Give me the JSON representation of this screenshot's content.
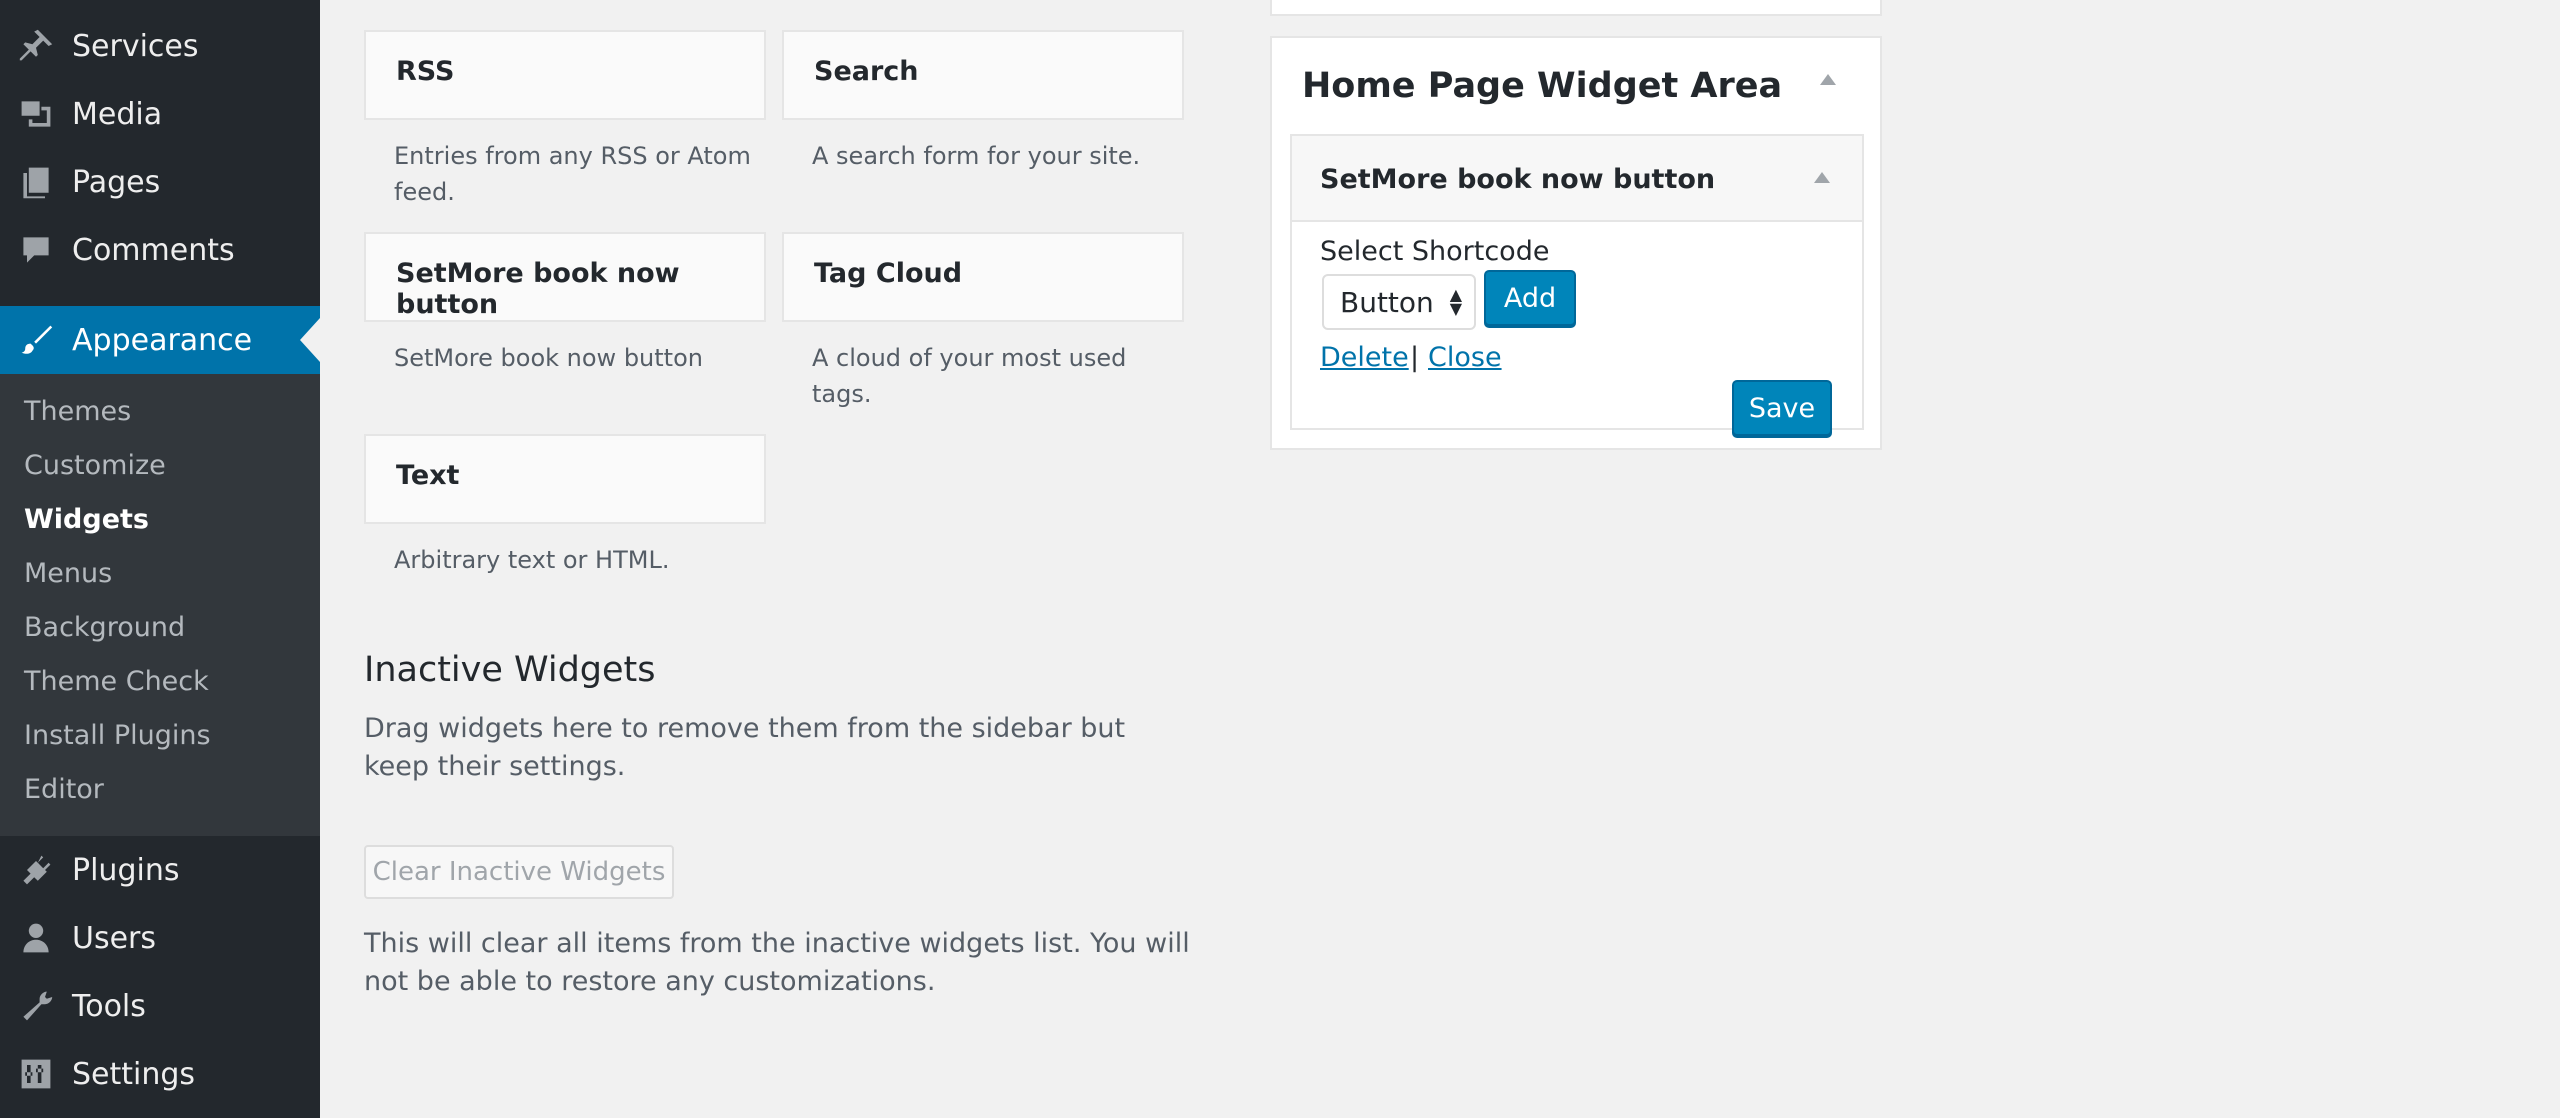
{
  "sidebar": {
    "menu": [
      {
        "label": "Services",
        "icon": "pin-icon"
      },
      {
        "label": "Media",
        "icon": "media-icon"
      },
      {
        "label": "Pages",
        "icon": "pages-icon"
      },
      {
        "label": "Comments",
        "icon": "comment-icon"
      },
      {
        "label": "Appearance",
        "icon": "brush-icon"
      },
      {
        "label": "Plugins",
        "icon": "plug-icon"
      },
      {
        "label": "Users",
        "icon": "user-icon"
      },
      {
        "label": "Tools",
        "icon": "wrench-icon"
      },
      {
        "label": "Settings",
        "icon": "settings-icon"
      }
    ],
    "submenu": [
      "Themes",
      "Customize",
      "Widgets",
      "Menus",
      "Background",
      "Theme Check",
      "Install Plugins",
      "Editor"
    ],
    "active_submenu": "Widgets",
    "accent_color": "#0073aa",
    "bg_color": "#23282d"
  },
  "widgets": [
    {
      "title": "RSS",
      "description": "Entries from any RSS or Atom feed."
    },
    {
      "title": "Search",
      "description": "A search form for your site."
    },
    {
      "title": "SetMore book now button",
      "description": "SetMore book now button"
    },
    {
      "title": "Tag Cloud",
      "description": "A cloud of your most used tags."
    },
    {
      "title": "Text",
      "description": "Arbitrary text or HTML."
    }
  ],
  "inactive": {
    "heading": "Inactive Widgets",
    "description": "Drag widgets here to remove them from the sidebar but keep their settings.",
    "clear_button": "Clear Inactive Widgets",
    "clear_description": "This will clear all items from the inactive widgets list. You will not be able to restore any customizations."
  },
  "widget_area": {
    "title": "Home Page Widget Area",
    "widget": {
      "title": "SetMore book now button",
      "select_label": "Select Shortcode",
      "select_value": "Button",
      "add_label": "Add",
      "delete_label": "Delete",
      "separator": "|",
      "close_label": "Close",
      "save_label": "Save"
    }
  }
}
